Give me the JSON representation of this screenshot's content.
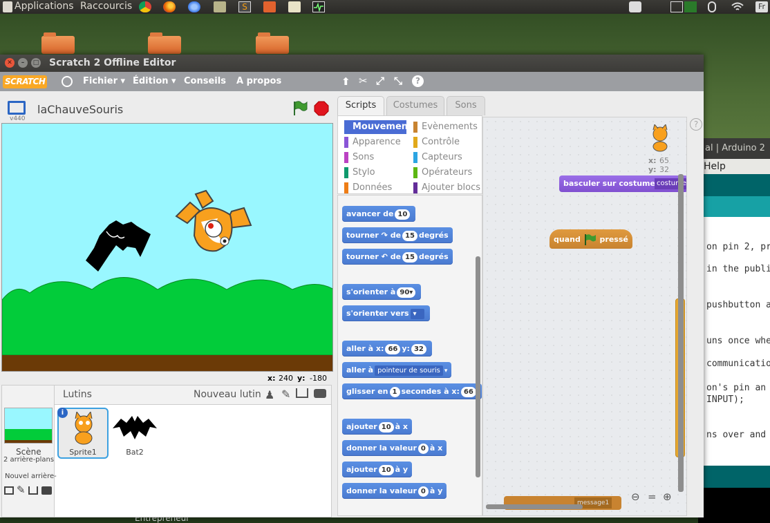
{
  "desktop": {
    "topbar": {
      "applications": "Applications",
      "shortcuts": "Raccourcis",
      "lang": "Fr"
    },
    "taskbar_text": "Entrepreneur"
  },
  "arduino_window": {
    "title": "al | Arduino 2",
    "menu": "Help",
    "code_lines": [
      "on pin 2, pr",
      "in the public",
      "pushbutton a",
      "uns once when",
      "communication",
      "on's pin an i",
      "INPUT);",
      "ns over and o"
    ]
  },
  "window": {
    "title": "Scratch 2 Offline Editor"
  },
  "menubar": {
    "logo": "SCRATCH",
    "items": [
      "Fichier ▾",
      "Édition ▾",
      "Conseils",
      "A propos"
    ]
  },
  "stage": {
    "version": "v440",
    "project_name": "laChauveSouris",
    "coords": {
      "x_label": "x:",
      "x": "240",
      "y_label": "y:",
      "y": "-180"
    }
  },
  "sprites_pane": {
    "title": "Lutins",
    "new_sprite": "Nouveau lutin",
    "scene_label": "Scène",
    "scene_sub": "2 arrière-plans",
    "new_backdrop": "Nouvel arrière-",
    "sprites": [
      {
        "name": "Sprite1",
        "selected": true
      },
      {
        "name": "Bat2",
        "selected": false
      }
    ]
  },
  "tabs": [
    "Scripts",
    "Costumes",
    "Sons"
  ],
  "categories": [
    {
      "label": "Mouvement",
      "color": "#4a6cd4",
      "active": true
    },
    {
      "label": "Evènements",
      "color": "#c88330"
    },
    {
      "label": "Apparence",
      "color": "#8a55d7"
    },
    {
      "label": "Contrôle",
      "color": "#e1a91a"
    },
    {
      "label": "Sons",
      "color": "#bb42c3"
    },
    {
      "label": "Capteurs",
      "color": "#2ca5e2"
    },
    {
      "label": "Stylo",
      "color": "#0e9a6c"
    },
    {
      "label": "Opérateurs",
      "color": "#5cb712"
    },
    {
      "label": "Données",
      "color": "#ee7d16"
    },
    {
      "label": "Ajouter blocs",
      "color": "#632d99"
    }
  ],
  "palette_blocks": {
    "avancer": {
      "label": "avancer de",
      "value": "10"
    },
    "tourner_right": {
      "label": "tourner",
      "de": "de",
      "value": "15",
      "unit": "degrés"
    },
    "tourner_left": {
      "label": "tourner",
      "de": "de",
      "value": "15",
      "unit": "degrés"
    },
    "orienter": {
      "label": "s'orienter à",
      "value": "90▾"
    },
    "orienter_vers": {
      "label": "s'orienter vers"
    },
    "aller_xy": {
      "label": "aller à x:",
      "x": "66",
      "y_label": "y:",
      "y": "32"
    },
    "aller_a": {
      "label": "aller à",
      "value": "pointeur de souris"
    },
    "glisser": {
      "label": "glisser en",
      "value": "1",
      "mid": "secondes à x:",
      "x": "66"
    },
    "ajouter_x": {
      "label": "ajouter",
      "value": "10",
      "suffix": "à x"
    },
    "donner_x": {
      "label": "donner la valeur",
      "value": "0",
      "suffix": "à x"
    },
    "ajouter_y": {
      "label": "ajouter",
      "value": "10",
      "suffix": "à y"
    },
    "donner_y": {
      "label": "donner la valeur",
      "value": "0",
      "suffix": "à y"
    }
  },
  "scripts_area": {
    "sprite_x_label": "x:",
    "sprite_x": "65",
    "sprite_y_label": "y:",
    "sprite_y": "32",
    "blocks": {
      "costume_block": {
        "label": "basculer sur costume",
        "value": "costume"
      },
      "hat_block": {
        "before": "quand",
        "after": "pressé"
      },
      "bottom_block": {
        "value": "message1"
      }
    }
  }
}
